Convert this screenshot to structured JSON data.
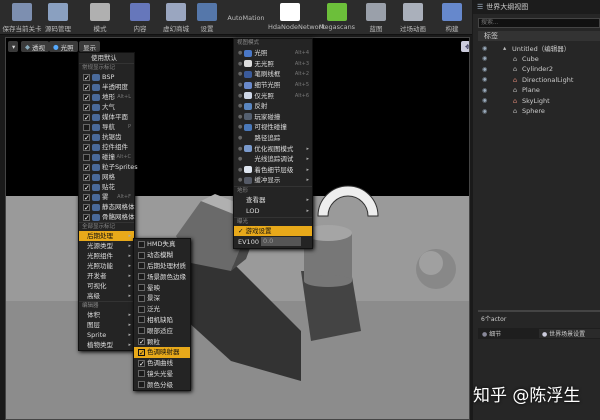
{
  "toolbar": [
    {
      "label": "保存当前关卡",
      "icon": "save-icon",
      "color": "#7d8fb0"
    },
    {
      "label": "源码管理",
      "icon": "source-control-icon",
      "color": "#8aa0c0"
    },
    {
      "label": "模式",
      "icon": "modes-icon",
      "color": "#b0b0b0"
    },
    {
      "label": "内容",
      "icon": "content-icon",
      "color": "#6677bb"
    },
    {
      "label": "虚幻商城",
      "icon": "marketplace-icon",
      "color": "#9aa6c0"
    },
    {
      "label": "设置",
      "icon": "settings-icon",
      "color": "#5577aa"
    },
    {
      "label": "AutoMation",
      "icon": "",
      "color": ""
    },
    {
      "label": "HdaNodeNetwork",
      "icon": "hda-icon",
      "color": "#ffffff"
    },
    {
      "label": "Megascans",
      "icon": "megascans-icon",
      "color": "#6cbf3a"
    },
    {
      "label": "蓝图",
      "icon": "blueprint-icon",
      "color": "#9aa0aa"
    },
    {
      "label": "过场动画",
      "icon": "cinematics-icon",
      "color": "#aab0bb"
    },
    {
      "label": "构建",
      "icon": "build-icon",
      "color": "#6688cc"
    }
  ],
  "viewport": {
    "perspective": "透视",
    "lit": "光照",
    "show": "显示"
  },
  "show_menu": {
    "use_default": "使用默认",
    "common_header": "常规显示标记",
    "common": [
      {
        "label": "BSP",
        "checked": true,
        "shortcut": ""
      },
      {
        "label": "半透明度",
        "checked": true,
        "shortcut": ""
      },
      {
        "label": "地形",
        "checked": true,
        "shortcut": "Alt+L"
      },
      {
        "label": "大气",
        "checked": true,
        "shortcut": ""
      },
      {
        "label": "媒体平面",
        "checked": true,
        "shortcut": ""
      },
      {
        "label": "导航",
        "checked": false,
        "shortcut": "P"
      },
      {
        "label": "抗锯齿",
        "checked": true,
        "shortcut": ""
      },
      {
        "label": "控件组件",
        "checked": true,
        "shortcut": ""
      },
      {
        "label": "碰撞",
        "checked": false,
        "shortcut": "Alt+C"
      },
      {
        "label": "粒子Sprites",
        "checked": true,
        "shortcut": ""
      },
      {
        "label": "网格",
        "checked": true,
        "shortcut": ""
      },
      {
        "label": "贴花",
        "checked": true,
        "shortcut": ""
      },
      {
        "label": "雾",
        "checked": true,
        "shortcut": "Alt+F"
      },
      {
        "label": "静态网格体",
        "checked": true,
        "shortcut": ""
      },
      {
        "label": "骨骼网格体",
        "checked": true,
        "shortcut": ""
      }
    ],
    "all_header": "全部显示标记",
    "all": [
      "后期处理",
      "光源类型",
      "光照组件",
      "光照功能",
      "开发者",
      "可视化",
      "高级"
    ],
    "editor_header": "编辑器",
    "editor": [
      "体积",
      "图层",
      "Sprite",
      "植物类型"
    ]
  },
  "post_menu": [
    {
      "label": "HMD失真",
      "checked": false
    },
    {
      "label": "动态模糊",
      "checked": false
    },
    {
      "label": "后期处理材质",
      "checked": false
    },
    {
      "label": "场景颜色边缘",
      "checked": false
    },
    {
      "label": "晕映",
      "checked": false
    },
    {
      "label": "景深",
      "checked": false
    },
    {
      "label": "泛光",
      "checked": false
    },
    {
      "label": "相机缺陷",
      "checked": false
    },
    {
      "label": "眼部适应",
      "checked": false
    },
    {
      "label": "颗粒",
      "checked": true
    },
    {
      "label": "色调映射器",
      "checked": true,
      "highlight": true
    },
    {
      "label": "色调曲线",
      "checked": true
    },
    {
      "label": "镜头光晕",
      "checked": false
    },
    {
      "label": "颜色分级",
      "checked": false
    }
  ],
  "view_menu": {
    "header": "视图模式",
    "modes": [
      {
        "label": "光照",
        "shortcut": "Alt+4",
        "color": "#4a78c8"
      },
      {
        "label": "无光照",
        "shortcut": "Alt+3",
        "color": "#dddddd"
      },
      {
        "label": "笔刷线框",
        "shortcut": "Alt+2",
        "color": "#3a5a9a"
      },
      {
        "label": "细节光照",
        "shortcut": "Alt+5",
        "color": "#6a8acc"
      },
      {
        "label": "仅光照",
        "shortcut": "Alt+6",
        "color": "#cfd8e8"
      },
      {
        "label": "反射",
        "shortcut": "",
        "color": "#5a86c0"
      },
      {
        "label": "玩家碰撞",
        "shortcut": "",
        "color": "#556070"
      },
      {
        "label": "可视性碰撞",
        "shortcut": "",
        "color": "#4a78b8"
      },
      {
        "label": "路径追踪",
        "shortcut": "",
        "color": ""
      },
      {
        "label": "优化视图模式",
        "shortcut": "",
        "color": "#7a9acc",
        "sub": true
      },
      {
        "label": "光线追踪调试",
        "shortcut": "",
        "color": "",
        "sub": true
      },
      {
        "label": "着色细节层级",
        "shortcut": "",
        "color": "#dfe6f0",
        "sub": true
      },
      {
        "label": "缓冲显示",
        "shortcut": "",
        "color": "#555a66",
        "sub": true
      }
    ],
    "landscape_header": "地形",
    "landscape": [
      "查看器",
      "LOD"
    ],
    "exposure_header": "曝光",
    "game_settings": "游戏设置",
    "ev_label": "EV100",
    "ev_value": "0.0"
  },
  "outliner": {
    "tab": "世界大纲视图",
    "search_placeholder": "搜索...",
    "column": "标签",
    "items": [
      {
        "label": "Untitled（编辑器）",
        "level": 0
      },
      {
        "label": "Cube",
        "level": 1
      },
      {
        "label": "Cylinder2",
        "level": 1
      },
      {
        "label": "DirectionalLight",
        "level": 1
      },
      {
        "label": "Plane",
        "level": 1
      },
      {
        "label": "SkyLight",
        "level": 1
      },
      {
        "label": "Sphere",
        "level": 1
      }
    ],
    "count": "6个actor",
    "details_tab": "细节",
    "world_settings_tab": "世界场景设置"
  },
  "watermark": "知乎 @陈浮生"
}
